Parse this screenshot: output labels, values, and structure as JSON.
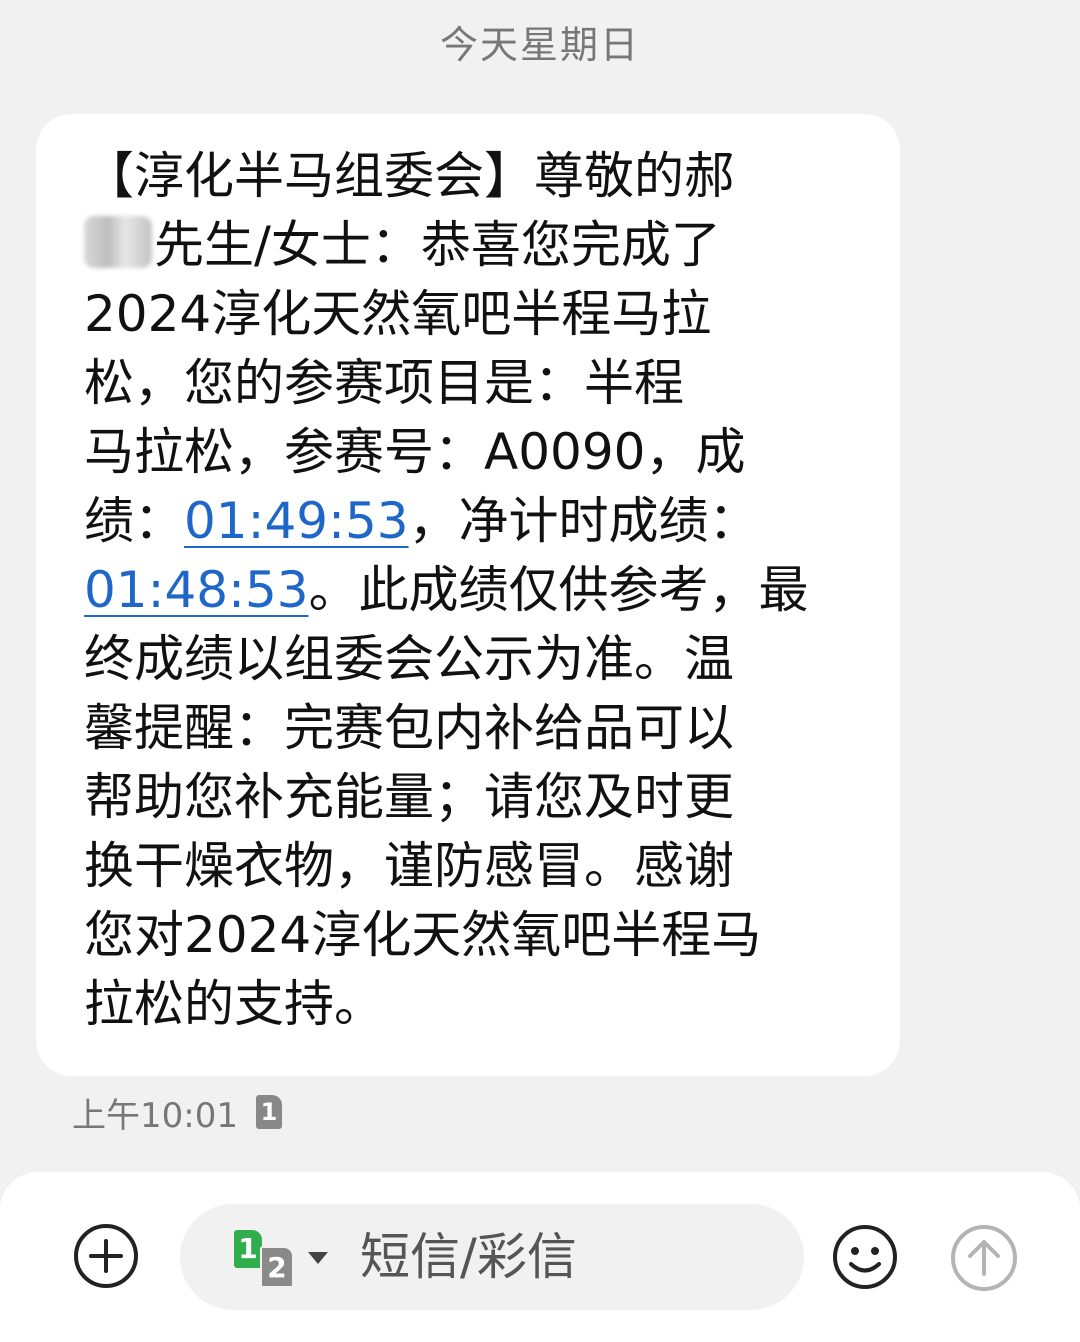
{
  "header": {
    "date_label": "今天星期日"
  },
  "message": {
    "lines": [
      "【淳化半马组委会】尊敬的郝",
      "先生/女士：恭喜您完成了",
      "2024淳化天然氧吧半程马拉",
      "松，您的参赛项目是：半程",
      "马拉松，参赛号：A0090，成",
      "绩：",
      "01:49:53",
      "，净计时成绩：",
      "01:48:53",
      "。此成绩仅供参考，最",
      "终成绩以组委会公示为准。温",
      "馨提醒：完赛包内补给品可以",
      "帮助您补充能量；请您及时更",
      "换干燥衣物，谨防感冒。感谢",
      "您对2024淳化天然氧吧半程马",
      "拉松的支持。"
    ],
    "time": "上午10:01",
    "sim_badge": "1"
  },
  "composer": {
    "sim1": "1",
    "sim2": "2",
    "placeholder": "短信/彩信"
  },
  "colors": {
    "link": "#1e67c8",
    "sim1": "#2fae4b",
    "background": "#f1f1f1"
  }
}
